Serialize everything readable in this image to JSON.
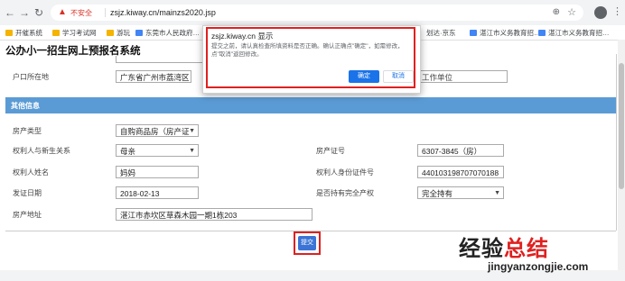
{
  "browser": {
    "insecure_label": "不安全",
    "url": "zsjz.kiway.cn/mainzs2020.jsp",
    "bookmarks": [
      "开催系统",
      "学习考试网",
      "游玩",
      "东莞市人民政府…",
      "划达·京东",
      "湛江市义务教育招…",
      "湛江市义务教育招…"
    ]
  },
  "page": {
    "title": "公办小一招生网上预报名系统",
    "hukou_label": "户口所在地",
    "hukou_value": "广东省广州市荔湾区",
    "work_unit_placeholder": "工作单位",
    "section_title": "其他信息",
    "fields": {
      "property_type_label": "房产类型",
      "property_type_value": "自购商品房（房产证",
      "relation_label": "权利人与新生关系",
      "relation_value": "母亲",
      "cert_no_label": "房产证号",
      "cert_no_value": "6307-3845（房）",
      "owner_name_label": "权利人姓名",
      "owner_name_value": "妈妈",
      "owner_id_label": "权利人身份证件号",
      "owner_id_value": "440103198707070188",
      "issue_date_label": "发证日期",
      "issue_date_value": "2018-02-13",
      "full_ownership_label": "是否持有完全产权",
      "full_ownership_value": "完全持有",
      "address_label": "房产地址",
      "address_value": "湛江市赤坎区草森木园一期1栋203"
    },
    "submit_label": "提交"
  },
  "dialog": {
    "title": "zsjz.kiway.cn 显示",
    "message": "提交之前，请认真检查所填资料是否正确。确认正确点\"确定\"，如需修改，点\"取消\"返回修改。",
    "ok_label": "确定",
    "cancel_label": "取消"
  },
  "watermark": {
    "main_a": "经验",
    "main_b": "总结",
    "sub": "jingyanzongjie.com"
  },
  "colors": {
    "section_bar": "#5b9bd5",
    "submit": "#3b74d6",
    "dialog_ok": "#1a73e8",
    "highlight": "#e02020"
  }
}
